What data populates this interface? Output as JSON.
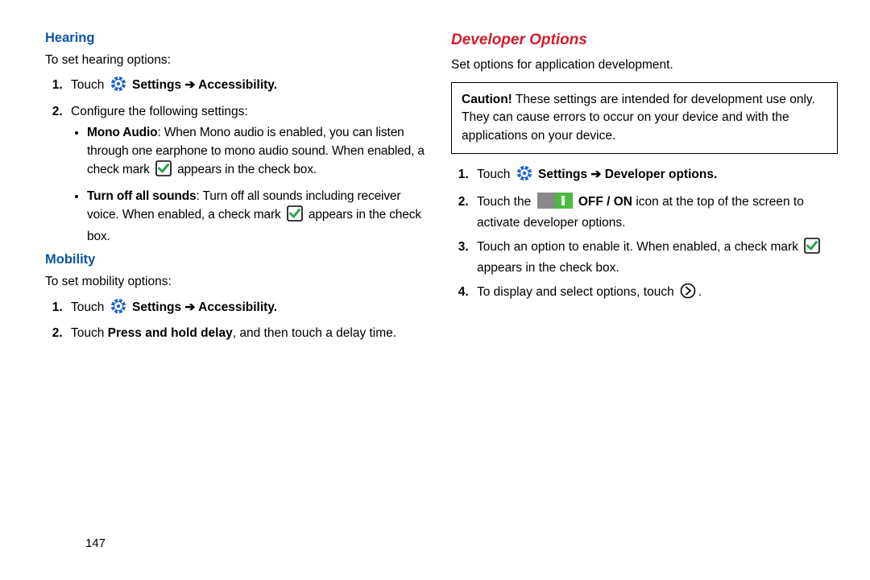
{
  "left": {
    "hearing": {
      "heading": "Hearing",
      "intro": "To set hearing options:",
      "step1_pre": "Touch ",
      "step1_bold": "Settings ➔ Accessibility.",
      "step2": "Configure the following settings:",
      "bullet1_label": "Mono Audio",
      "bullet1_a": ": When Mono audio is enabled, you can listen through one earphone to mono audio sound. When enabled, a check mark ",
      "bullet1_b": " appears in the check box.",
      "bullet2_label": "Turn off all sounds",
      "bullet2_a": ": Turn off all sounds including receiver voice. When enabled, a check mark ",
      "bullet2_b": " appears in the check box."
    },
    "mobility": {
      "heading": "Mobility",
      "intro": "To set mobility options:",
      "step1_pre": "Touch ",
      "step1_bold": "Settings ➔ Accessibility.",
      "step2_a": "Touch ",
      "step2_bold": "Press and hold delay",
      "step2_b": ", and then touch a delay time."
    }
  },
  "right": {
    "heading": "Developer Options",
    "intro": "Set options for application development.",
    "caution_label": "Caution!",
    "caution_text": " These settings are intended for development use only. They can cause errors to occur on your device and with the applications on your device.",
    "s1_pre": "Touch ",
    "s1_bold": "Settings ➔ Developer options.",
    "s2_a": "Touch the ",
    "s2_bold": " OFF / ON",
    "s2_b": " icon at the top of the screen to activate developer options.",
    "s3_a": "Touch an option to enable it. When enabled, a check mark ",
    "s3_b": " appears in the check box.",
    "s4": "To display and select options, touch "
  },
  "page_number": "147"
}
